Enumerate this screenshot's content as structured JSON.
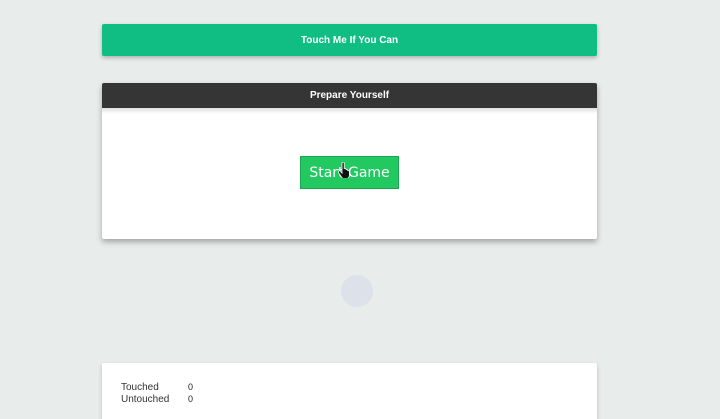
{
  "banner": {
    "title": "Touch Me If You Can"
  },
  "prepare": {
    "header": "Prepare Yourself",
    "start_button_label": "Start Game"
  },
  "stats": {
    "touched_label": "Touched",
    "touched_value": "0",
    "untouched_label": "Untouched",
    "untouched_value": "0"
  },
  "colors": {
    "banner": "#10bd82",
    "header": "#353535",
    "start_button": "#22c960",
    "background": "#e8ecea",
    "target": "#dde1e9"
  },
  "icons": {
    "cursor": "hand-pointer-icon"
  }
}
